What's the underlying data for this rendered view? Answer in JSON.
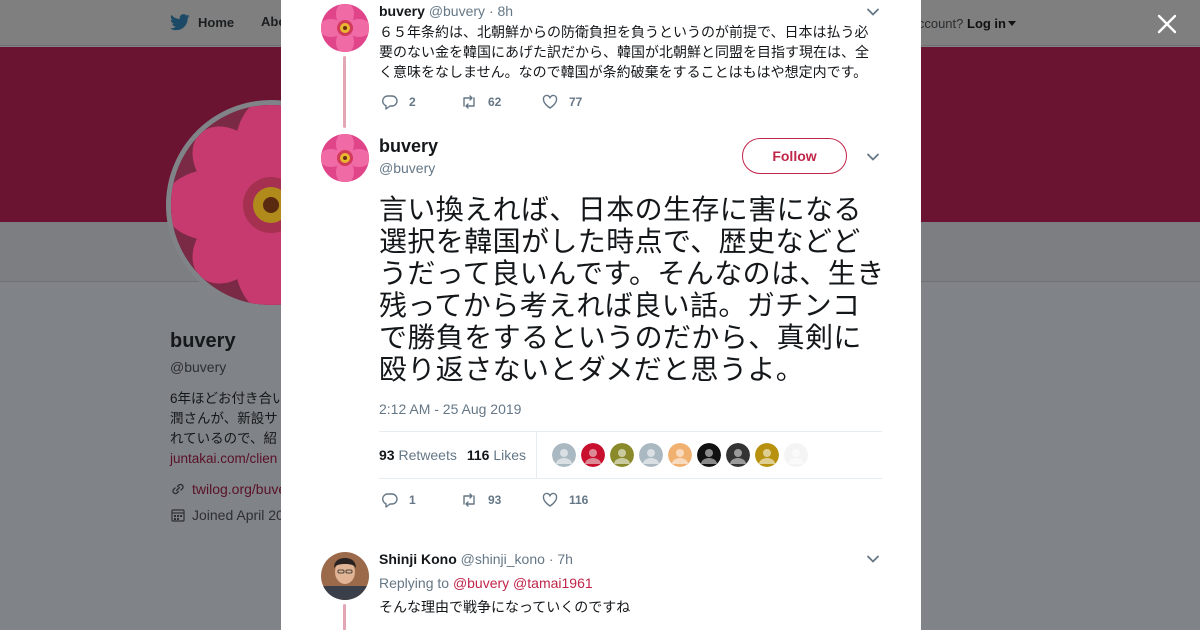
{
  "background": {
    "nav": {
      "home": "Home",
      "about": "Abo",
      "account_question": "account?",
      "login": "Log in"
    },
    "profile": {
      "name": "buvery",
      "handle": "@buvery",
      "bio_lines": [
        "6年ほどお付き合い",
        "潤さんが、新設サ",
        "れているので、紹"
      ],
      "bio_link": "juntakai.com/clien",
      "website": "twilog.org/buve",
      "joined": "Joined April 20"
    }
  },
  "modal": {
    "parent_tweet": {
      "name": "buvery",
      "handle": "@buvery",
      "time": "· 8h",
      "text": "６５年条約は、北朝鮮からの防衛負担を負うというのが前提で、日本は払う必要のない金を韓国にあげた訳だから、韓国が北朝鮮と同盟を目指す現在は、全く意味をなしません。なので韓国が条約破棄をすることはもはや想定内です。",
      "replies": "2",
      "retweets": "62",
      "likes": "77"
    },
    "main_tweet": {
      "name": "buvery",
      "handle": "@buvery",
      "follow_label": "Follow",
      "text": "言い換えれば、日本の生存に害になる選択を韓国がした時点で、歴史などどうだって良いんです。そんなのは、生き残ってから考えれば良い話。ガチンコで勝負をするというのだから、真剣に殴り返さないとダメだと思うよ。",
      "timestamp": "2:12 AM - 25 Aug 2019",
      "retweet_count": "93",
      "retweet_label": "Retweets",
      "like_count": "116",
      "like_label": "Likes",
      "replies": "1",
      "retweets": "93",
      "likes": "116",
      "likers": [
        "#aab8c2",
        "#c8102e",
        "#8a8a2a",
        "#aab8c2",
        "#f0b070",
        "#111111",
        "#333333",
        "#b8920f",
        "#f4f4f4"
      ]
    },
    "reply_tweet": {
      "name": "Shinji Kono",
      "handle": "@shinji_kono",
      "time": "· 7h",
      "replying_prefix": "Replying to",
      "replying_mentions": "@buvery @tamai1961",
      "text": "そんな理由で戦争になっていくのですね"
    }
  },
  "colors": {
    "accent": "#c0254a",
    "muted": "#657786",
    "text": "#14171a",
    "banner": "#6a1431"
  }
}
